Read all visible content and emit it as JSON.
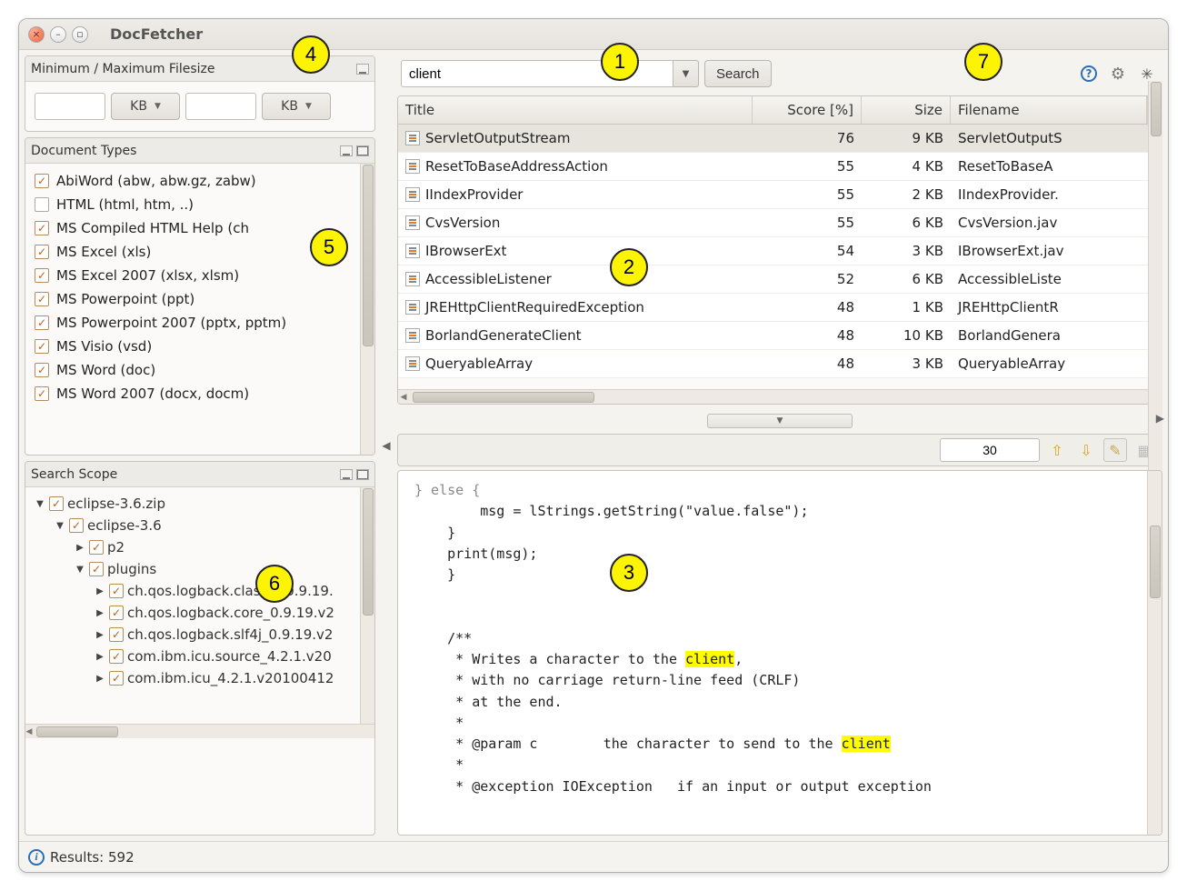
{
  "app_title": "DocFetcher",
  "filesize_panel": {
    "title": "Minimum / Maximum Filesize",
    "unit_min": "KB",
    "unit_max": "KB"
  },
  "doctypes_panel": {
    "title": "Document Types",
    "items": [
      {
        "label": "AbiWord (abw, abw.gz, zabw)",
        "checked": true
      },
      {
        "label": "HTML (html, htm, ..)",
        "checked": false
      },
      {
        "label": "MS Compiled HTML Help (ch",
        "checked": true
      },
      {
        "label": "MS Excel (xls)",
        "checked": true
      },
      {
        "label": "MS Excel 2007 (xlsx, xlsm)",
        "checked": true
      },
      {
        "label": "MS Powerpoint (ppt)",
        "checked": true
      },
      {
        "label": "MS Powerpoint 2007 (pptx, pptm)",
        "checked": true
      },
      {
        "label": "MS Visio (vsd)",
        "checked": true
      },
      {
        "label": "MS Word (doc)",
        "checked": true
      },
      {
        "label": "MS Word 2007 (docx, docm)",
        "checked": true
      }
    ]
  },
  "scope_panel": {
    "title": "Search Scope",
    "tree": [
      {
        "level": 0,
        "expand": "▼",
        "label": "eclipse-3.6.zip"
      },
      {
        "level": 1,
        "expand": "▼",
        "label": "eclipse-3.6"
      },
      {
        "level": 2,
        "expand": "▶",
        "label": "p2"
      },
      {
        "level": 2,
        "expand": "▼",
        "label": "plugins"
      },
      {
        "level": 3,
        "expand": "▶",
        "label": "ch.qos.logback.classic_0.9.19."
      },
      {
        "level": 3,
        "expand": "▶",
        "label": "ch.qos.logback.core_0.9.19.v2"
      },
      {
        "level": 3,
        "expand": "▶",
        "label": "ch.qos.logback.slf4j_0.9.19.v2"
      },
      {
        "level": 3,
        "expand": "▶",
        "label": "com.ibm.icu.source_4.2.1.v20"
      },
      {
        "level": 3,
        "expand": "▶",
        "label": "com.ibm.icu_4.2.1.v20100412"
      }
    ]
  },
  "search": {
    "query": "client",
    "button": "Search"
  },
  "columns": {
    "title": "Title",
    "score": "Score [%]",
    "size": "Size",
    "filename": "Filename"
  },
  "results": [
    {
      "title": "ServletOutputStream",
      "score": "76",
      "size": "9 KB",
      "filename": "ServletOutputS",
      "selected": true
    },
    {
      "title": "ResetToBaseAddressAction",
      "score": "55",
      "size": "4 KB",
      "filename": "ResetToBaseA"
    },
    {
      "title": "IIndexProvider",
      "score": "55",
      "size": "2 KB",
      "filename": "IIndexProvider."
    },
    {
      "title": "CvsVersion",
      "score": "55",
      "size": "6 KB",
      "filename": "CvsVersion.jav"
    },
    {
      "title": "IBrowserExt",
      "score": "54",
      "size": "3 KB",
      "filename": "IBrowserExt.jav"
    },
    {
      "title": "AccessibleListener",
      "score": "52",
      "size": "6 KB",
      "filename": "AccessibleListe"
    },
    {
      "title": "JREHttpClientRequiredException",
      "score": "48",
      "size": "1 KB",
      "filename": "JREHttpClientR"
    },
    {
      "title": "BorlandGenerateClient",
      "score": "48",
      "size": "10 KB",
      "filename": "BorlandGenera"
    },
    {
      "title": "QueryableArray",
      "score": "48",
      "size": "3 KB",
      "filename": "QueryableArray"
    }
  ],
  "preview_toolbar": {
    "occurrence": "30"
  },
  "preview": {
    "l1": "        msg = lStrings.getString(\"value.false\");",
    "l2": "    }",
    "l3": "    print(msg);",
    "l4": "    }",
    "l5": "",
    "l6": "",
    "l7": "    /**",
    "l8a": "     * Writes a character to the ",
    "hl1": "client",
    "l8b": ",",
    "l9": "     * with no carriage return-line feed (CRLF)",
    "l10": "     * at the end.",
    "l11": "     *",
    "l12a": "     * @param c        the character to send to the ",
    "hl2": "client",
    "l13": "     *",
    "l14": "     * @exception IOException   if an input or output exception"
  },
  "status": {
    "label": "Results: 592"
  },
  "callouts": {
    "c1": "1",
    "c2": "2",
    "c3": "3",
    "c4": "4",
    "c5": "5",
    "c6": "6",
    "c7": "7"
  }
}
